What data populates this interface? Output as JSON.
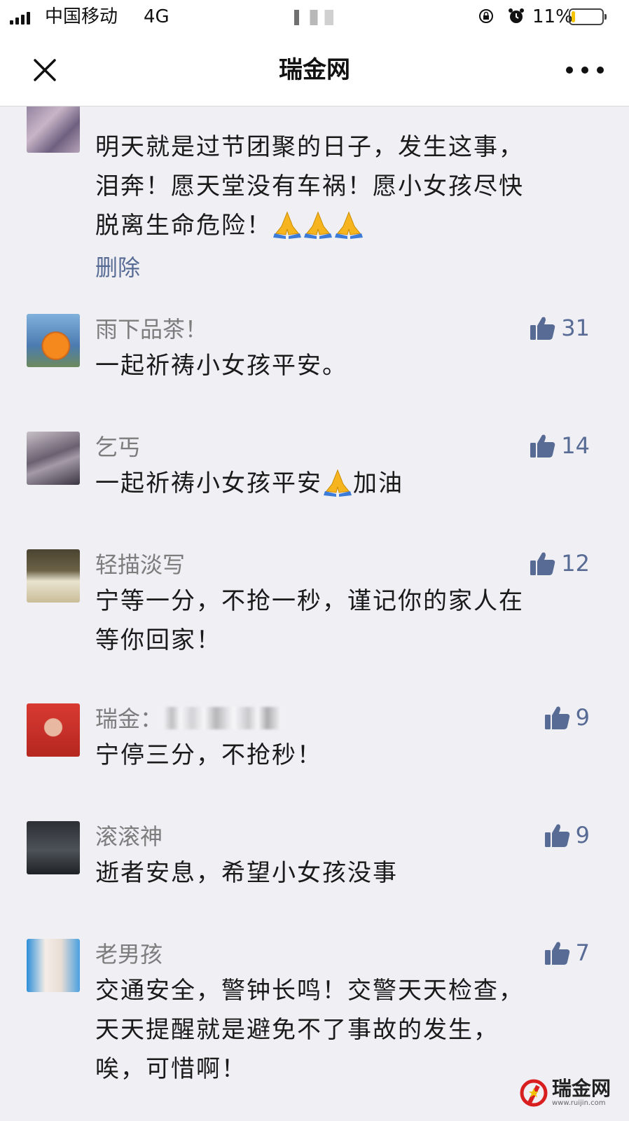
{
  "status_bar": {
    "carrier": "中国移动",
    "network": "4G",
    "battery_percent": "11%",
    "battery_level": 0.11,
    "battery_color": "#f5c400"
  },
  "nav": {
    "title": "瑞金网",
    "close_icon": "close-icon",
    "more_icon": "more-dots-icon"
  },
  "comments": [
    {
      "text_lines": [
        "明天就是过节团聚的日子，发生这事，",
        "泪奔！愿天堂没有车祸！愿小女孩尽快",
        "脱离生命危险！"
      ],
      "emoji": "pray-icon",
      "delete_label": "删除"
    },
    {
      "name": "雨下品茶！",
      "likes": "31",
      "text": "一起祈祷小女孩平安。"
    },
    {
      "name": "乞丐",
      "likes": "14",
      "text": "一起祈祷小女孩平安",
      "text_after_emoji": "加油"
    },
    {
      "name": "轻描淡写",
      "likes": "12",
      "text_lines": [
        "宁等一分，不抢一秒，谨记你的家人在",
        "等你回家！"
      ]
    },
    {
      "name": "瑞金：",
      "likes": "9",
      "text": "宁停三分，不抢秒！"
    },
    {
      "name": "滚滚神",
      "likes": "9",
      "text": "逝者安息，希望小女孩没事"
    },
    {
      "name": "老男孩",
      "likes": "7",
      "text_lines": [
        "交通安全，警钟长鸣！交警天天检查，",
        "天天提醒就是避免不了事故的发生，",
        "唉，可惜啊！"
      ]
    }
  ],
  "watermark": {
    "text": "瑞金网",
    "url": "www.ruijin.com"
  },
  "colors": {
    "link": "#576b95",
    "name": "#7d7d7d",
    "background": "#efeff4"
  }
}
